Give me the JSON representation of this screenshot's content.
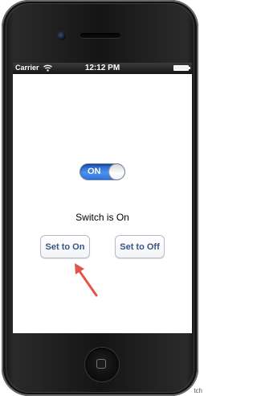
{
  "status_bar": {
    "carrier": "Carrier",
    "time": "12:12 PM"
  },
  "switch": {
    "state_label": "ON",
    "is_on": true
  },
  "status_text": "Switch is On",
  "buttons": {
    "set_on": "Set to On",
    "set_off": "Set to Off"
  },
  "icons": {
    "wifi": "wifi-icon",
    "battery": "battery-icon",
    "arrow": "arrow-icon",
    "home": "home-button-icon"
  },
  "colors": {
    "switch_on": "#2f74dd",
    "button_text": "#385487",
    "arrow": "#e0574a"
  },
  "corner_text": "tch"
}
